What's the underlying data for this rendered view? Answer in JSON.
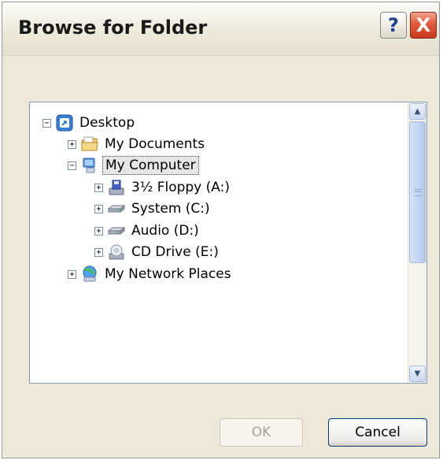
{
  "dialog": {
    "title": "Browse for Folder",
    "help_glyph": "?",
    "close_glyph": "X"
  },
  "tree": {
    "items": [
      {
        "label": "Desktop",
        "icon": "desktop-icon",
        "expander": "−"
      },
      {
        "label": "My Documents",
        "icon": "folder-icon",
        "expander": "+"
      },
      {
        "label": "My Computer",
        "icon": "computer-icon",
        "expander": "−"
      },
      {
        "label": "3½ Floppy (A:)",
        "icon": "floppy-drive-icon",
        "expander": "+"
      },
      {
        "label": "System (C:)",
        "icon": "hard-drive-icon",
        "expander": "+"
      },
      {
        "label": "Audio (D:)",
        "icon": "hard-drive-icon",
        "expander": "+"
      },
      {
        "label": "CD Drive (E:)",
        "icon": "cd-drive-icon",
        "expander": "+"
      },
      {
        "label": "My Network Places",
        "icon": "network-icon",
        "expander": "+"
      }
    ],
    "selected": "My Computer"
  },
  "buttons": {
    "ok_label": "OK",
    "cancel_label": "Cancel"
  },
  "colors": {
    "window_bg": "#ece9d8",
    "close_red": "#e05a3c",
    "panel_border": "#7f9db9"
  }
}
